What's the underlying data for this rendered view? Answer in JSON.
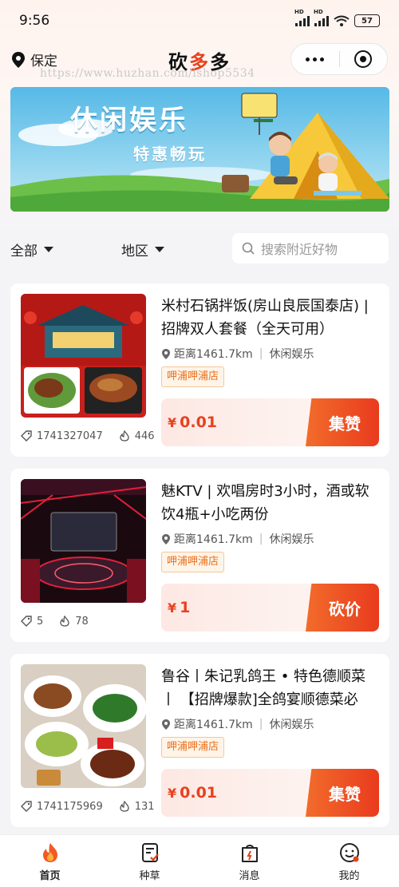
{
  "status_bar": {
    "time": "9:56",
    "battery": "57",
    "signal_label": "HD"
  },
  "header": {
    "location": "保定",
    "app_title_left": "砍",
    "app_title_mid": "多",
    "app_title_right": "多"
  },
  "watermark": "https://www.huzhan.com/ishop5534",
  "banner": {
    "title": "休闲娱乐",
    "subtitle": "特惠畅玩"
  },
  "filter": {
    "all_label": "全部",
    "region_label": "地区",
    "search_placeholder": "搜索附近好物"
  },
  "cards": [
    {
      "title": "米村石锅拌饭(房山良辰国泰店) | 招牌双人套餐（全天可用）",
      "distance": "距离1461.7km",
      "category": "休闲娱乐",
      "tag": "呷浦呷浦店",
      "price": "0.01",
      "currency": "¥",
      "action": "集赞",
      "stat_tag": "1741327047",
      "stat_hot": "446"
    },
    {
      "title": "魅KTV | 欢唱房时3小时，酒或软饮4瓶+小吃两份",
      "distance": "距离1461.7km",
      "category": "休闲娱乐",
      "tag": "呷浦呷浦店",
      "price": "1",
      "currency": "¥",
      "action": "砍价",
      "stat_tag": "5",
      "stat_hot": "78"
    },
    {
      "title": "鲁谷丨朱记乳鸽王 • 特色德顺菜 丨 【招牌爆款]全鸽宴顺德菜必",
      "distance": "距离1461.7km",
      "category": "休闲娱乐",
      "tag": "呷浦呷浦店",
      "price": "0.01",
      "currency": "¥",
      "action": "集赞",
      "stat_tag": "1741175969",
      "stat_hot": "131"
    }
  ],
  "tabbar": [
    {
      "label": "首页",
      "icon": "home-flame-icon",
      "active": true
    },
    {
      "label": "种草",
      "icon": "note-check-icon",
      "active": false
    },
    {
      "label": "消息",
      "icon": "message-bag-icon",
      "active": false
    },
    {
      "label": "我的",
      "icon": "smile-face-icon",
      "active": false
    }
  ],
  "colors": {
    "accent": "#e8411f",
    "accent_orange": "#f26c2b",
    "tag_orange": "#e8701d"
  }
}
